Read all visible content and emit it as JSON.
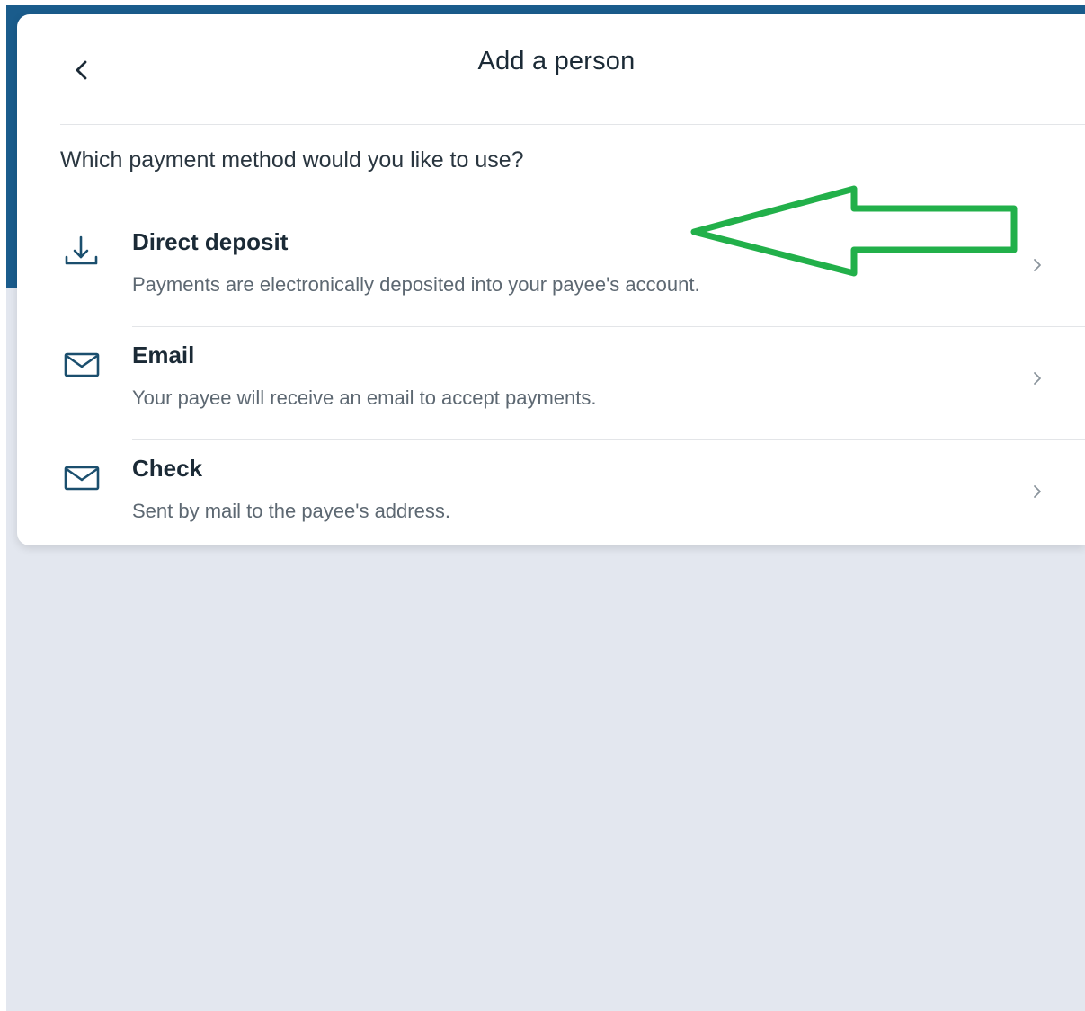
{
  "dialog": {
    "title": "Add a person",
    "back_icon": "chevron-left-icon"
  },
  "question": "Which payment method would you like to use?",
  "options": [
    {
      "icon": "download-icon",
      "title": "Direct deposit",
      "description": "Payments are electronically deposited into your payee's account."
    },
    {
      "icon": "mail-icon",
      "title": "Email",
      "description": "Your payee will receive an email to accept payments."
    },
    {
      "icon": "mail-icon",
      "title": "Check",
      "description": "Sent by mail to the payee's address."
    }
  ],
  "colors": {
    "brand_band": "#1a5c8c",
    "page_background": "#e3e7ef",
    "icon": "#1b4f6e",
    "annotation_arrow": "#22b04a"
  }
}
